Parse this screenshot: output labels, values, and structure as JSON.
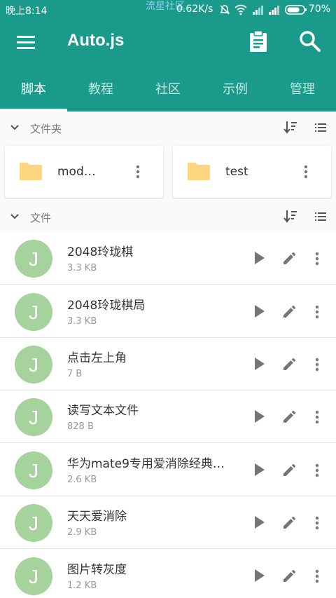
{
  "status_bar": {
    "time": "晚上8:14",
    "watermark": "流星社区",
    "speed": "0.62K/s",
    "battery": "70%"
  },
  "app_bar": {
    "title": "Auto.js"
  },
  "tabs": [
    {
      "label": "脚本",
      "active": true
    },
    {
      "label": "教程",
      "active": false
    },
    {
      "label": "社区",
      "active": false
    },
    {
      "label": "示例",
      "active": false
    },
    {
      "label": "管理",
      "active": false
    }
  ],
  "folders_section": {
    "label": "文件夹",
    "folders": [
      {
        "name": "mod…"
      },
      {
        "name": "test"
      }
    ]
  },
  "files_section": {
    "label": "文件",
    "files": [
      {
        "avatar": "J",
        "name": "2048玲珑棋",
        "size": "3.3 KB"
      },
      {
        "avatar": "J",
        "name": "2048玲珑棋局",
        "size": "3.3 KB"
      },
      {
        "avatar": "J",
        "name": "点击左上角",
        "size": "7 B"
      },
      {
        "avatar": "J",
        "name": "读写文本文件",
        "size": "828 B"
      },
      {
        "avatar": "J",
        "name": "华为mate9专用爱消除经典…",
        "size": "2.6 KB"
      },
      {
        "avatar": "J",
        "name": "天天爱消除",
        "size": "2.9 KB"
      },
      {
        "avatar": "J",
        "name": "图片转灰度",
        "size": "1.2 KB"
      }
    ]
  },
  "colors": {
    "primary": "#1a9a8a",
    "avatar": "#a6d29d",
    "folder": "#ffd680"
  }
}
